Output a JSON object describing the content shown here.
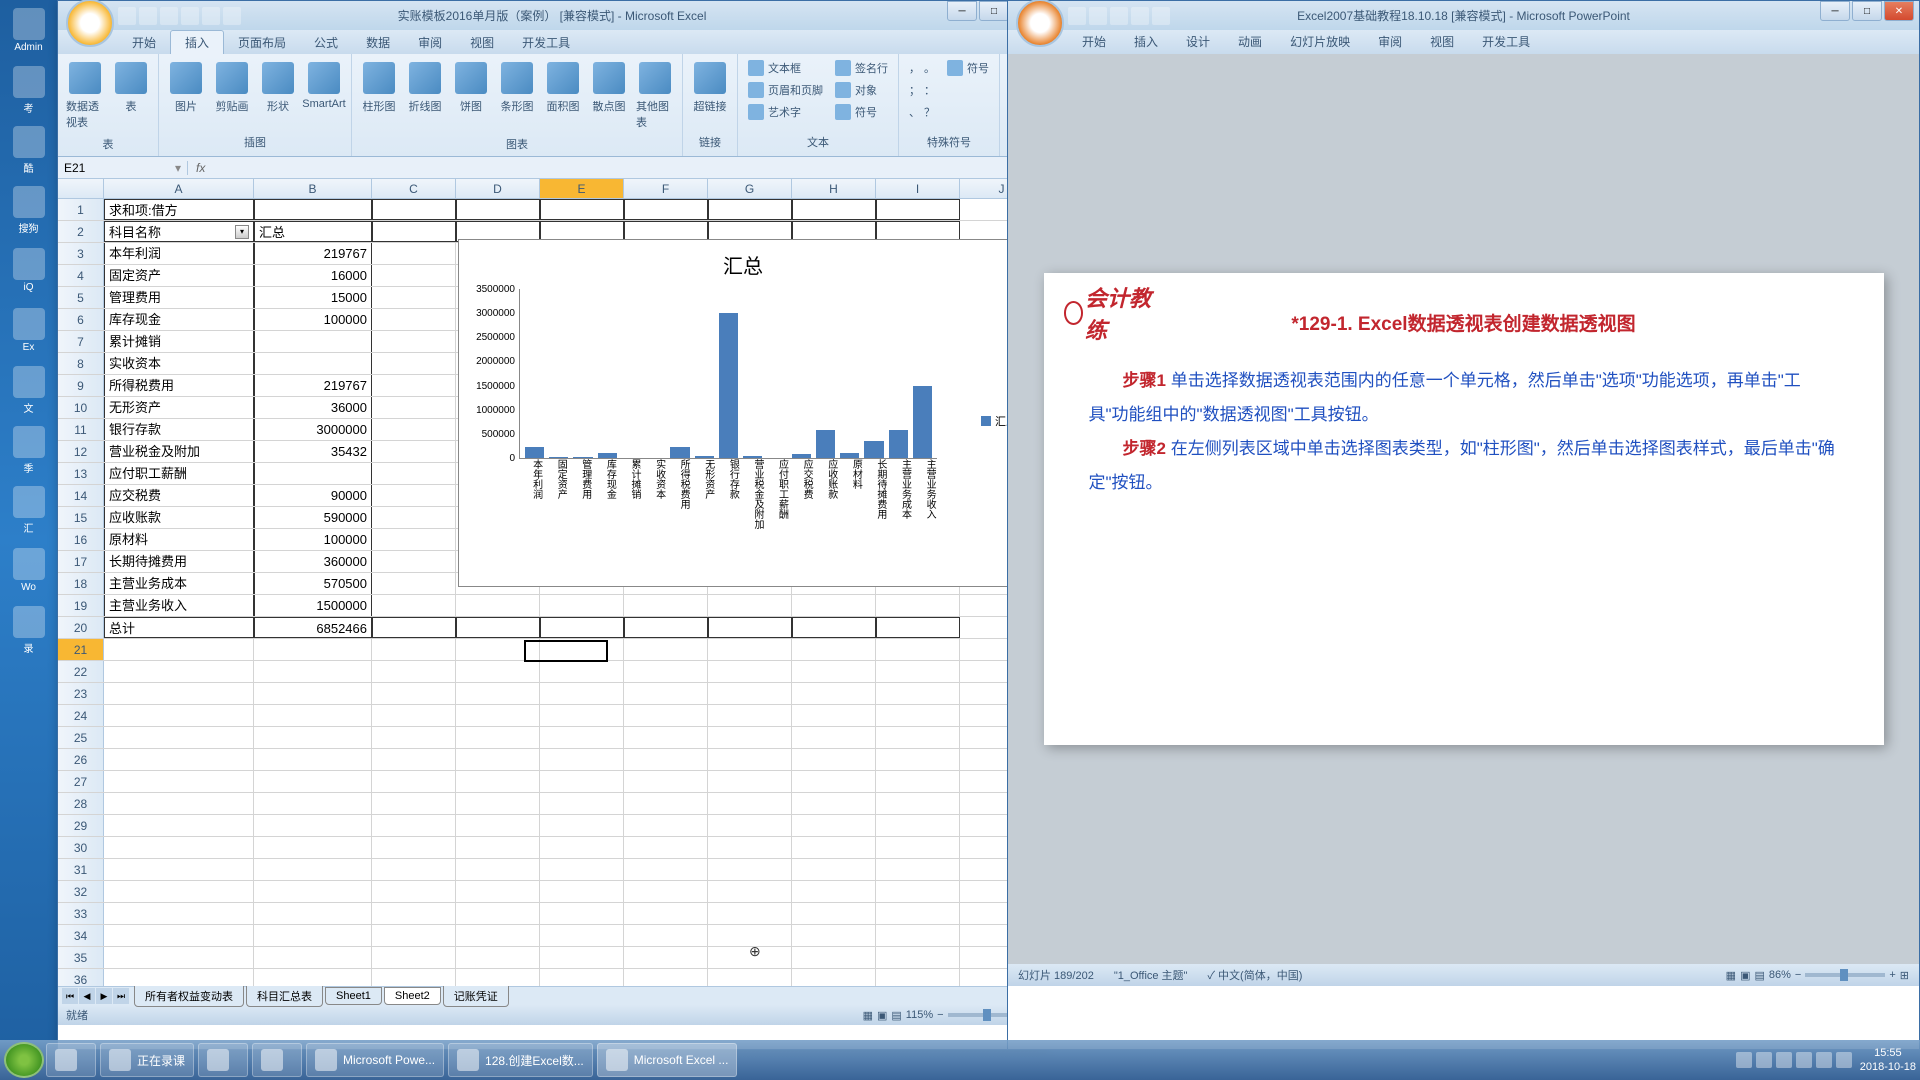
{
  "desktop": {
    "icons": [
      "Admin",
      "考",
      "酷",
      "搜狗",
      "iQ",
      "Ex",
      "文",
      "季",
      "汇",
      "Wo",
      "录"
    ]
  },
  "excel": {
    "title": "实账模板2016单月版（案例） [兼容模式] - Microsoft Excel",
    "tabs": [
      "开始",
      "插入",
      "页面布局",
      "公式",
      "数据",
      "审阅",
      "视图",
      "开发工具"
    ],
    "active_tab": "插入",
    "ribbon_groups": {
      "tables": {
        "label": "表",
        "btns": [
          "数据透视表",
          "表"
        ]
      },
      "illustrations": {
        "label": "插图",
        "btns": [
          "图片",
          "剪贴画",
          "形状",
          "SmartArt"
        ]
      },
      "charts": {
        "label": "图表",
        "btns": [
          "柱形图",
          "折线图",
          "饼图",
          "条形图",
          "面积图",
          "散点图",
          "其他图表"
        ]
      },
      "links": {
        "label": "链接",
        "btns": [
          "超链接"
        ]
      },
      "text": {
        "label": "文本",
        "items": [
          "文本框",
          "页眉和页脚",
          "艺术字",
          "签名行",
          "对象",
          "符号"
        ]
      },
      "symbols": {
        "label": "特殊符号",
        "items": [
          "，",
          "。",
          "；",
          "：",
          "、",
          "？",
          "符号"
        ]
      }
    },
    "name_box": "E21",
    "columns": [
      "A",
      "B",
      "C",
      "D",
      "E",
      "F",
      "G",
      "H",
      "I",
      "J"
    ],
    "pivot": {
      "r1_a": "求和项:借方",
      "r2_a": "科目名称",
      "r2_b": "汇总",
      "total_a": "总计",
      "total_b": "6852466"
    },
    "rows": [
      {
        "n": "3",
        "a": "本年利润",
        "b": "219767"
      },
      {
        "n": "4",
        "a": "固定资产",
        "b": "16000"
      },
      {
        "n": "5",
        "a": "管理费用",
        "b": "15000"
      },
      {
        "n": "6",
        "a": "库存现金",
        "b": "100000"
      },
      {
        "n": "7",
        "a": "累计摊销",
        "b": ""
      },
      {
        "n": "8",
        "a": "实收资本",
        "b": ""
      },
      {
        "n": "9",
        "a": "所得税费用",
        "b": "219767"
      },
      {
        "n": "10",
        "a": "无形资产",
        "b": "36000"
      },
      {
        "n": "11",
        "a": "银行存款",
        "b": "3000000"
      },
      {
        "n": "12",
        "a": "营业税金及附加",
        "b": "35432"
      },
      {
        "n": "13",
        "a": "应付职工薪酬",
        "b": ""
      },
      {
        "n": "14",
        "a": "应交税费",
        "b": "90000"
      },
      {
        "n": "15",
        "a": "应收账款",
        "b": "590000"
      },
      {
        "n": "16",
        "a": "原材料",
        "b": "100000"
      },
      {
        "n": "17",
        "a": "长期待摊费用",
        "b": "360000"
      },
      {
        "n": "18",
        "a": "主营业务成本",
        "b": "570500"
      },
      {
        "n": "19",
        "a": "主营业务收入",
        "b": "1500000"
      }
    ],
    "empty_rows": [
      "21",
      "22",
      "23",
      "24",
      "25",
      "26",
      "27",
      "28",
      "29",
      "30",
      "31",
      "32",
      "33",
      "34",
      "35",
      "36"
    ],
    "sheet_tabs": [
      "所有者权益变动表",
      "科目汇总表",
      "Sheet1",
      "Sheet2",
      "记账凭证"
    ],
    "active_sheet": "Sheet2",
    "status": "就绪",
    "zoom": "115%"
  },
  "chart_data": {
    "type": "bar",
    "title": "汇总",
    "legend": "汇总",
    "ylim": [
      0,
      3500000
    ],
    "yticks": [
      "0",
      "500000",
      "1000000",
      "1500000",
      "2000000",
      "2500000",
      "3000000",
      "3500000"
    ],
    "categories": [
      "本年利润",
      "固定资产",
      "管理费用",
      "库存现金",
      "累计摊销",
      "实收资本",
      "所得税费用",
      "无形资产",
      "银行存款",
      "营业税金及附加",
      "应付职工薪酬",
      "应交税费",
      "应收账款",
      "原材料",
      "长期待摊费用",
      "主营业务成本",
      "主营业务收入"
    ],
    "values": [
      219767,
      16000,
      15000,
      100000,
      0,
      0,
      219767,
      36000,
      3000000,
      35432,
      0,
      90000,
      590000,
      100000,
      360000,
      570500,
      1500000
    ]
  },
  "ppt": {
    "title": "Excel2007基础教程18.10.18 [兼容模式] - Microsoft PowerPoint",
    "tabs": [
      "开始",
      "插入",
      "设计",
      "动画",
      "幻灯片放映",
      "审阅",
      "视图",
      "开发工具"
    ],
    "logo_text": "会计教练",
    "slide": {
      "title": "*129-1. Excel数据透视表创建数据透视图",
      "step1_label": "步骤1",
      "step1_text": " 单击选择数据透视表范围内的任意一个单元格，然后单击\"选项\"功能选项，再单击\"工具\"功能组中的\"数据透视图\"工具按钮。",
      "step2_label": "步骤2",
      "step2_text": " 在左侧列表区域中单击选择图表类型，如\"柱形图\"，然后单击选择图表样式，最后单击\"确定\"按钮。"
    },
    "status_left": "幻灯片 189/202",
    "status_theme": "\"1_Office 主题\"",
    "status_lang": "中文(简体，中国)",
    "zoom": "86%"
  },
  "taskbar": {
    "items": [
      {
        "label": ""
      },
      {
        "label": ""
      },
      {
        "label": "正在录课"
      },
      {
        "label": ""
      },
      {
        "label": ""
      },
      {
        "label": "Microsoft Powe..."
      },
      {
        "label": "128.创建Excel数..."
      },
      {
        "label": "Microsoft Excel ..."
      }
    ],
    "time": "15:55",
    "date": "2018-10-18"
  }
}
